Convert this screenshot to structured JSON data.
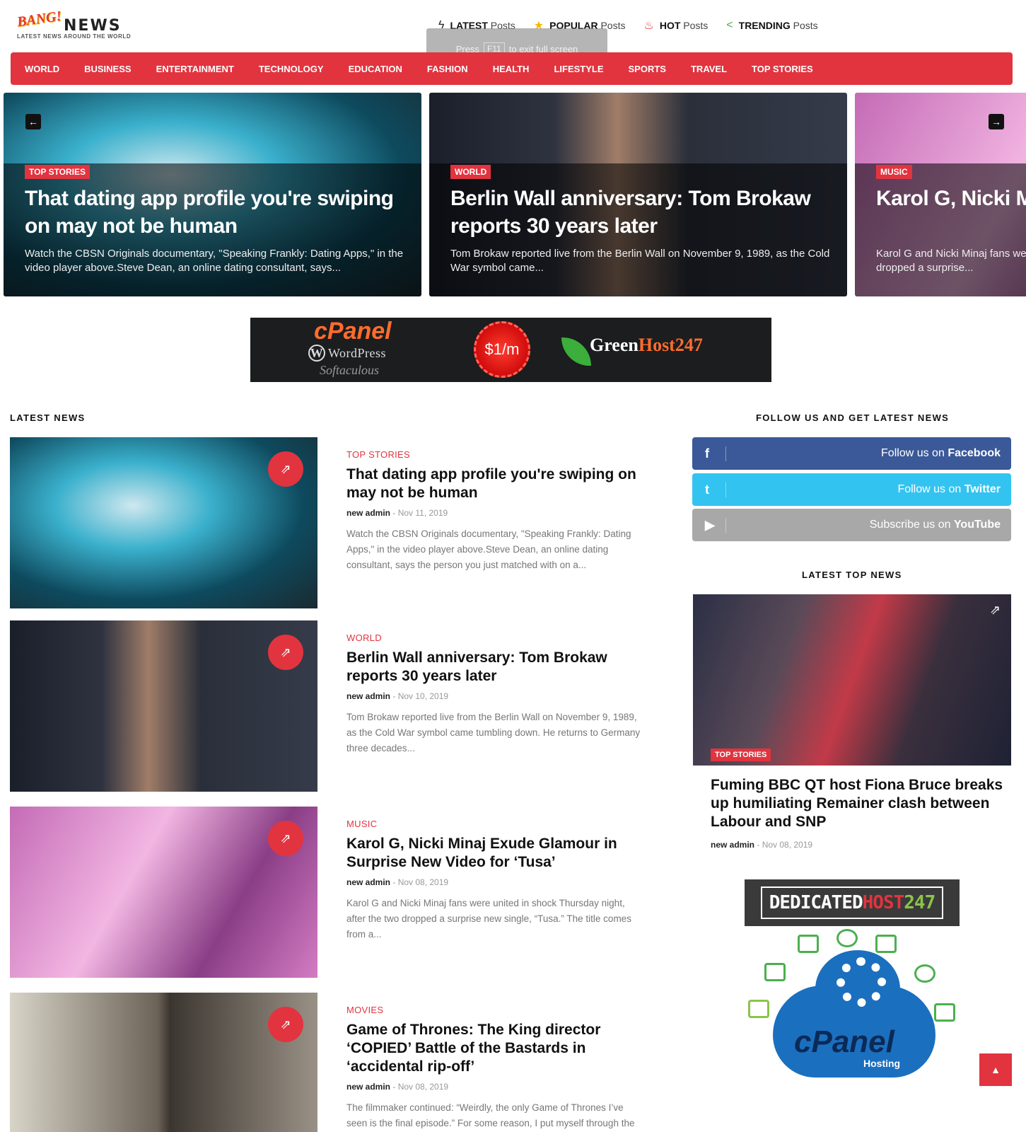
{
  "logo": {
    "bang": "BANG!",
    "news": "NEWS",
    "tagline": "LATEST NEWS AROUND THE WORLD"
  },
  "top_nav": [
    {
      "icon": "bolt-icon",
      "bold": "LATEST",
      "light": "Posts"
    },
    {
      "icon": "star-icon",
      "bold": "POPULAR",
      "light": "Posts"
    },
    {
      "icon": "flame-icon",
      "bold": "HOT",
      "light": "Posts"
    },
    {
      "icon": "share-icon",
      "bold": "TRENDING",
      "light": "Posts"
    }
  ],
  "fullscreen_hint": {
    "press": "Press",
    "key": "F11",
    "rest": "to exit full screen"
  },
  "main_nav": [
    "WORLD",
    "BUSINESS",
    "ENTERTAINMENT",
    "TECHNOLOGY",
    "EDUCATION",
    "FASHION",
    "HEALTH",
    "LIFESTYLE",
    "SPORTS",
    "TRAVEL",
    "TOP STORIES"
  ],
  "slider": [
    {
      "category": "TOP STORIES",
      "title": "That dating app profile you're swiping on may not be human",
      "desc": "Watch the CBSN Originals documentary, \"Speaking Frankly: Dating Apps,\" in the video player above.Steve Dean, an online dating consultant, says..."
    },
    {
      "category": "WORLD",
      "title": "Berlin Wall anniversary: Tom Brokaw reports 30 years later",
      "desc": "Tom Brokaw reported live from the Berlin Wall on November 9, 1989, as the Cold War symbol came..."
    },
    {
      "category": "MUSIC",
      "title": "Karol G, Nicki Minaj Exude Glamour in Surprise New Video for ‘Tusa’",
      "desc": "Karol G and Nicki Minaj fans were united in shock Thursday night, after the two dropped a surprise..."
    }
  ],
  "banner": {
    "cpanel": "cPanel",
    "wordpress": "WordPress",
    "script": "Softaculous",
    "price": "$1/m",
    "brand_a": "Green",
    "brand_b": "Host247"
  },
  "latest_news": {
    "heading": "LATEST NEWS",
    "posts": [
      {
        "category": "TOP STORIES",
        "title": "That dating app profile you're swiping on may not be human",
        "author": "new admin",
        "date": "Nov 11, 2019",
        "excerpt": "Watch the CBSN Originals documentary, \"Speaking Frankly: Dating Apps,\" in the video player above.Steve Dean, an online dating consultant, says the person you just matched with on a..."
      },
      {
        "category": "WORLD",
        "title": "Berlin Wall anniversary: Tom Brokaw reports 30 years later",
        "author": "new admin",
        "date": "Nov 10, 2019",
        "excerpt": "Tom Brokaw reported live from the Berlin Wall on November 9, 1989, as the Cold War symbol came tumbling down. He returns to Germany three decades..."
      },
      {
        "category": "MUSIC",
        "title": "Karol G, Nicki Minaj Exude Glamour in Surprise New Video for ‘Tusa’",
        "author": "new admin",
        "date": "Nov 08, 2019",
        "excerpt": "Karol G and Nicki Minaj fans were united in shock Thursday night, after the two dropped a surprise new single, “Tusa.” The title comes from a..."
      },
      {
        "category": "MOVIES",
        "title": "Game of Thrones: The King director ‘COPIED’ Battle of the Bastards in ‘accidental rip-off’",
        "author": "new admin",
        "date": "Nov 08, 2019",
        "excerpt": "The filmmaker continued: “Weirdly, the only Game of Thrones I’ve seen is the final episode.” For some reason, I put myself through the"
      }
    ]
  },
  "sidebar": {
    "follow_heading": "FOLLOW US AND GET LATEST NEWS",
    "social": [
      {
        "icon": "facebook-icon",
        "glyph": "f",
        "text": "Follow us on",
        "network": "Facebook",
        "color": "#3b5998"
      },
      {
        "icon": "twitter-icon",
        "glyph": "t",
        "text": "Follow us on",
        "network": "Twitter",
        "color": "#33c3f0"
      },
      {
        "icon": "youtube-icon",
        "glyph": "▶",
        "text": "Subscribe us on",
        "network": "YouTube",
        "color": "#a8a8a8"
      }
    ],
    "top_news_heading": "LATEST TOP NEWS",
    "top_news": {
      "category": "TOP STORIES",
      "title": "Fuming BBC QT host Fiona Bruce breaks up humiliating Remainer clash between Labour and SNP",
      "author": "new admin",
      "date": "Nov 08, 2019"
    },
    "ad": {
      "brand_a": "DEDICATED",
      "brand_b": "HOST",
      "brand_c": "247",
      "cpanel": "cPanel",
      "hosting": "Hosting"
    }
  },
  "colors": {
    "accent": "#e1343f"
  }
}
